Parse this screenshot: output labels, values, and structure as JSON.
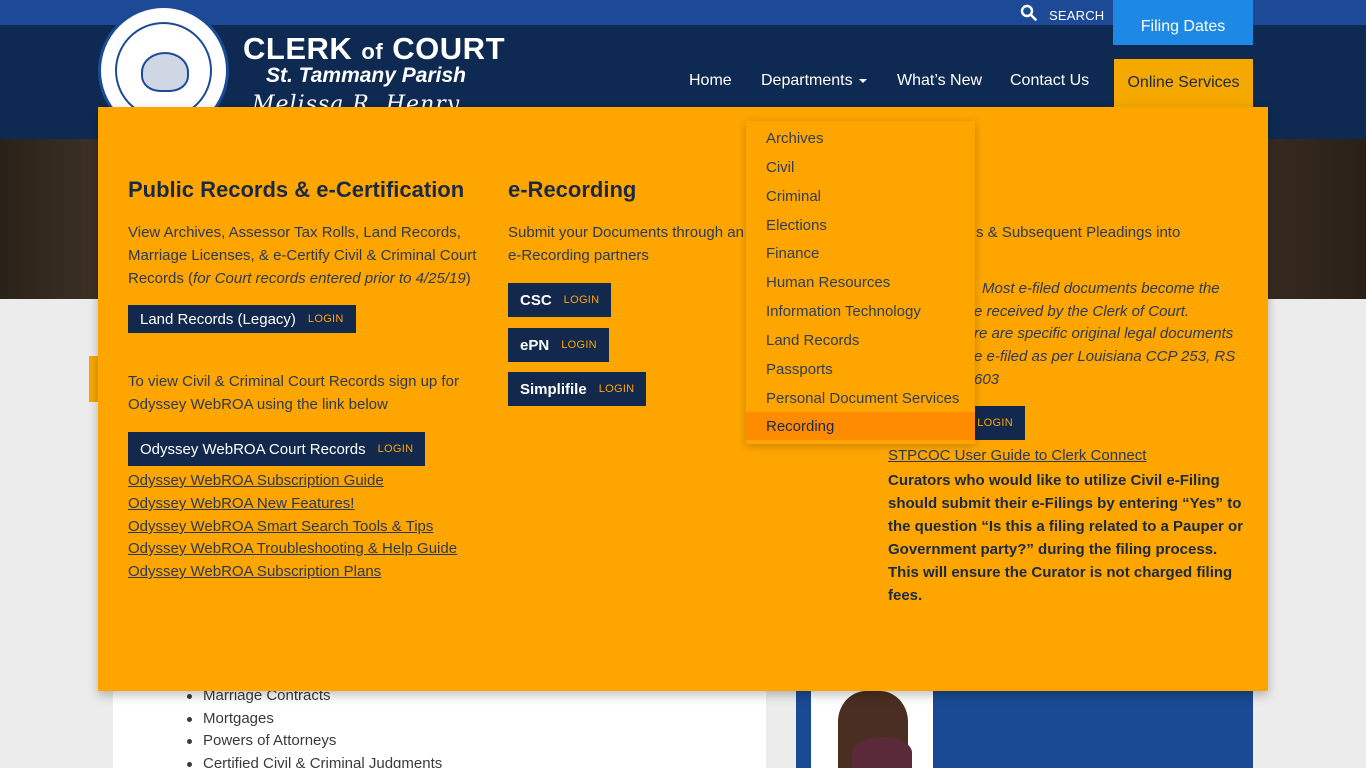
{
  "header": {
    "search_label": "SEARCH",
    "filing_dates": "Filing Dates",
    "title_clerk": "CLERK",
    "title_of": "of",
    "title_court": "COURT",
    "subtitle": "St. Tammany Parish",
    "signature": "Melissa R. Henry"
  },
  "nav": {
    "home": "Home",
    "departments": "Departments",
    "whats_new": "What’s New",
    "contact": "Contact Us",
    "online_services": "Online Services"
  },
  "mega": {
    "col1": {
      "title": "Public Records & e-Certification",
      "para1_text": "View Archives, Assessor Tax Rolls, Land Records, Marriage Licenses, & e-Certify Civil & Criminal Court Records (",
      "para1_italic": "for Court records entered prior to 4/25/19",
      "para1_end": ")",
      "land_records_btn": "Land Records (Legacy)",
      "login": "LOGIN",
      "para2": "To view Civil & Criminal Court Records sign up for Odyssey WebROA using the link below",
      "odyssey_btn": "Odyssey WebROA Court Records",
      "links": [
        "Odyssey WebROA Subscription Guide",
        "Odyssey WebROA New Features!",
        "Odyssey WebROA Smart Search Tools & Tips",
        "Odyssey WebROA Troubleshooting & Help Guide",
        "Odyssey WebROA Subscription Plans"
      ]
    },
    "col2": {
      "title": "e-Recording",
      "para": "Submit your Documents through any of our e-Recording partners",
      "para_visible_1": "Submit your Documents through an",
      "para_visible_2": "e-Recording partners",
      "buttons": [
        "CSC",
        "ePN",
        "Simplifile"
      ],
      "login": "LOGIN"
    },
    "col3": {
      "para_fragment": "s & Subsequent Pleadings into",
      "italic_lines": [
        "Most e-filed documents become the",
        "e received by the Clerk of Court.",
        "re are specific original legal documents",
        "e e-filed as per Louisiana CCP 253, RS",
        "603"
      ],
      "login": "LOGIN",
      "guide_link": "STPCOC User Guide to Clerk Connect",
      "note": "Curators who would like to utilize Civil e-Filing should submit their e-Filings by entering “Yes” to the question “Is this a filing related to a Pauper or Government party?” during the filing process. This will ensure the Curator is not charged filing fees."
    }
  },
  "departments_menu": {
    "items": [
      "Archives",
      "Civil",
      "Criminal",
      "Elections",
      "Finance",
      "Human Resources",
      "Information Technology",
      "Land Records",
      "Passports",
      "Personal Document Services",
      "Recording"
    ],
    "active": "Recording"
  },
  "content": {
    "bullets": [
      "Marriage Contracts",
      "Mortgages",
      "Powers of Attorneys",
      "Certified Civil & Criminal Judgments"
    ]
  },
  "colors": {
    "navy": "#0e2a52",
    "top_blue": "#1d4a97",
    "orange": "#fea500",
    "button_dark": "#12284d",
    "filing_blue": "#1e88e5"
  }
}
